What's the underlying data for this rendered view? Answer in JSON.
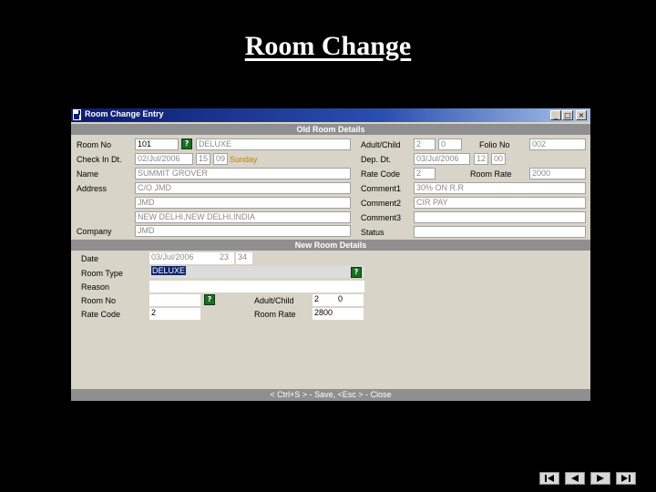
{
  "slide": {
    "title": "Room Change"
  },
  "window": {
    "title": "Room Change Entry",
    "buttons": {
      "minimize": "_",
      "maximize": "□",
      "close": "×"
    }
  },
  "old_section": {
    "header": "Old Room Details",
    "room_no_label": "Room No",
    "room_no": "101",
    "room_type": "DELUXE",
    "checkin_label": "Check In Dt.",
    "checkin_date": "02/Jul/2006",
    "checkin_hour": "15",
    "checkin_min": "09",
    "checkin_day": "Sunday",
    "name_label": "Name",
    "name": "SUMMIT GROVER",
    "address_label": "Address",
    "address1": "C/O JMD",
    "address2": "JMD",
    "address3": "NEW DELHI,NEW DELHI,INDIA",
    "company_label": "Company",
    "company": "JMD",
    "adult_child_label": "Adult/Child",
    "adults": "2",
    "children": "0",
    "folio_label": "Folio No",
    "folio": "002",
    "dep_label": "Dep. Dt.",
    "dep_date": "03/Jul/2006",
    "dep_hour": "12",
    "dep_min": "00",
    "rate_code_label": "Rate Code",
    "rate_code": "2",
    "room_rate_label": "Room Rate",
    "room_rate": "2000",
    "comment1_label": "Comment1",
    "comment1": "30% ON R.R",
    "comment2_label": "Comment2",
    "comment2": "CIR PAY",
    "comment3_label": "Comment3",
    "comment3": "",
    "status_label": "Status",
    "status": ""
  },
  "new_section": {
    "header": "New Room Details",
    "date_label": "Date",
    "date": "03/Jul/2006",
    "hour": "23",
    "min": "34",
    "room_type_label": "Room Type",
    "room_type": "DELUXE",
    "reason_label": "Reason",
    "reason": "",
    "room_no_label": "Room No",
    "room_no": "",
    "rate_code_label": "Rate Code",
    "rate_code": "2",
    "adult_child_label": "Adult/Child",
    "adults": "2",
    "children": "0",
    "room_rate_label": "Room Rate",
    "room_rate": "2800"
  },
  "statusbar": {
    "text": "< Ctrl+S > - Save, <Esc > - Close"
  },
  "colors": {
    "titlebar": "#0c1b6e",
    "section": "#8f8f8f",
    "panel": "#d8d4c8"
  }
}
